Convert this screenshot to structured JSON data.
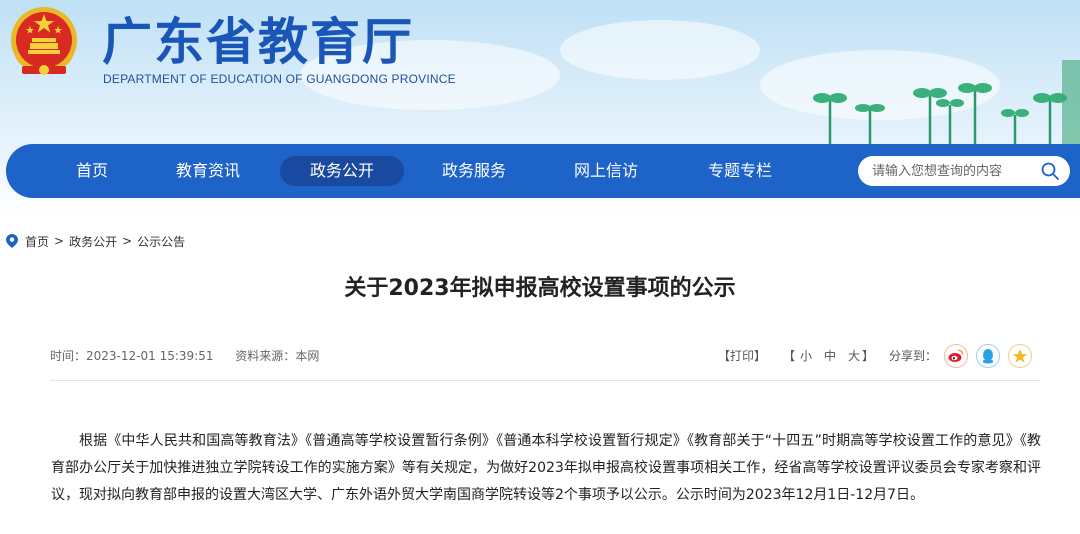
{
  "header": {
    "title": "广东省教育厅",
    "subtitle": "DEPARTMENT OF EDUCATION OF GUANGDONG PROVINCE",
    "emblem_icon": "national-emblem-icon"
  },
  "nav": {
    "items": [
      {
        "label": "首页"
      },
      {
        "label": "教育资讯"
      },
      {
        "label": "政务公开",
        "active": true
      },
      {
        "label": "政务服务"
      },
      {
        "label": "网上信访"
      },
      {
        "label": "专题专栏"
      }
    ],
    "search_placeholder": "请输入您想查询的内容",
    "colors": {
      "bar": "#1e63c7",
      "active": "#1a4aa0"
    }
  },
  "breadcrumb": {
    "items": [
      "首页",
      "政务公开",
      "公示公告"
    ],
    "separator": ">"
  },
  "article": {
    "title": "关于2023年拟申报高校设置事项的公示",
    "time_label": "时间：",
    "time": "2023-12-01 15:39:51",
    "source_label": "资料来源：",
    "source": "本网",
    "print": "【打印】",
    "font_open": "【",
    "font_small": "小",
    "font_medium": "中",
    "font_large": "大",
    "font_close": "】",
    "share_label": "分享到：",
    "share_icons": [
      "weibo-icon",
      "qq-icon",
      "qzone-star-icon"
    ],
    "body": "根据《中华人民共和国高等教育法》《普通高等学校设置暂行条例》《普通本科学校设置暂行规定》《教育部关于“十四五”时期高等学校设置工作的意见》《教育部办公厅关于加快推进独立学院转设工作的实施方案》等有关规定，为做好2023年拟申报高校设置事项相关工作，经省高等学校设置评议委员会专家考察和评议，现对拟向教育部申报的设置大湾区大学、广东外语外贸大学南国商学院转设等2个事项予以公示。公示时间为2023年12月1日-12月7日。"
  }
}
